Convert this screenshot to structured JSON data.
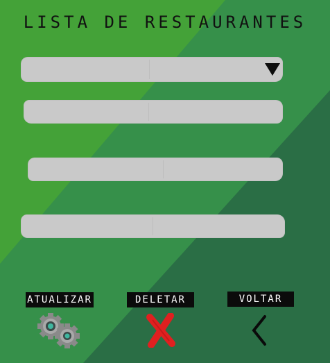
{
  "page": {
    "title": "LISTA DE RESTAURANTES"
  },
  "colors": {
    "bg_light": "#44a238",
    "bg_mid": "#36904a",
    "bg_dark": "#2a6e45",
    "field": "#c9c9c9",
    "label_bg": "#0b0b0b",
    "label_text": "#ffffff",
    "delete_icon": "#e02020"
  },
  "form": {
    "restaurant_select": {
      "value": "",
      "icon": "triangle-down-icon"
    },
    "field_2": {
      "value": "",
      "placeholder": ""
    },
    "field_3": {
      "value": "",
      "placeholder": ""
    },
    "field_4": {
      "value": "",
      "placeholder": ""
    }
  },
  "actions": {
    "update": {
      "label": "ATUALIZAR",
      "icon": "gears-icon"
    },
    "delete": {
      "label": "DELETAR",
      "icon": "x-cross-icon"
    },
    "back": {
      "label": "VOLTAR",
      "icon": "chevron-left-icon"
    }
  }
}
